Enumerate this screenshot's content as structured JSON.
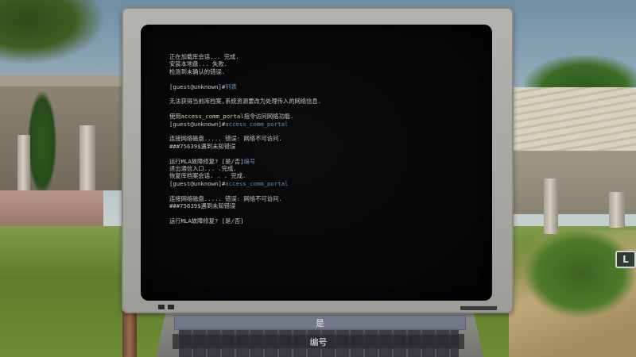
{
  "terminal": {
    "lines": [
      {
        "text": "正在加载库会话... 完成."
      },
      {
        "text": "安装本地盘... 失败."
      },
      {
        "text": "检测到未确认的错误."
      },
      {
        "text": ""
      },
      {
        "prompt": "[guest@unknown]#",
        "cmd": "列表"
      },
      {
        "text": ""
      },
      {
        "text": "无法获得当前库档案,系统资源要改为处理传入的网络信息."
      },
      {
        "text": ""
      },
      {
        "pre": "使用",
        "hl": "access_comm_portal",
        "post": "指令访问网络功能."
      },
      {
        "prompt": "[guest@unknown]#",
        "cmd": "access_comm_portal"
      },
      {
        "text": ""
      },
      {
        "text": "连接网络磁盘..... 错误: 网络不可访问."
      },
      {
        "text": "###75639$遇到未知错误"
      },
      {
        "text": ""
      },
      {
        "text": "运行MLA故障修复? [是/否]",
        "cmd": "编号"
      },
      {
        "text": "退出通信入口... .完成."
      },
      {
        "text": "恢复库档案会话. . . 完成."
      },
      {
        "prompt": "[guest@unknown]#",
        "cmd": "access_comm_portal"
      },
      {
        "text": ""
      },
      {
        "text": "连接网络磁盘..... 错误: 网络不可访问."
      },
      {
        "text": "###75639$遇到未知错误"
      },
      {
        "text": ""
      },
      {
        "text": "运行MLA故障修复? [是/否]"
      }
    ]
  },
  "choices": {
    "yes_label": "是",
    "id_label": "编号"
  },
  "signpost": {
    "letter": "L"
  },
  "colors": {
    "accent": "#5f8fb0",
    "text": "#c7c7c0",
    "highlight": "#d5d3a0",
    "screen": "#060607"
  }
}
